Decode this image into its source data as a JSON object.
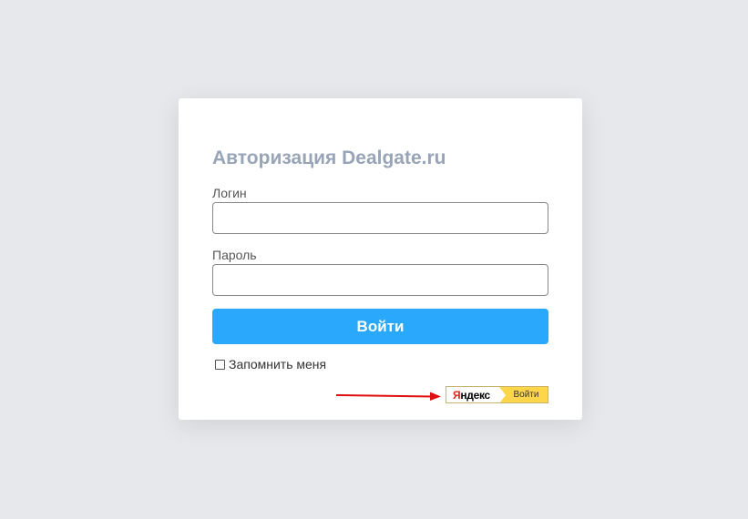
{
  "auth": {
    "title": "Авторизация Dealgate.ru",
    "login_label": "Логин",
    "login_value": "",
    "password_label": "Пароль",
    "password_value": "",
    "submit_label": "Войти",
    "remember_label": "Запомнить меня",
    "remember_checked": false
  },
  "yandex": {
    "logo_first_letter": "Я",
    "logo_rest": "ндекс",
    "button_label": "Войти"
  },
  "colors": {
    "page_background": "#e6e8ec",
    "title": "#98a4b7",
    "primary_button": "#2aa9fc",
    "yandex_yellow": "#ffd64a",
    "yandex_red": "#e5271d",
    "annotation_arrow": "#e01010"
  }
}
